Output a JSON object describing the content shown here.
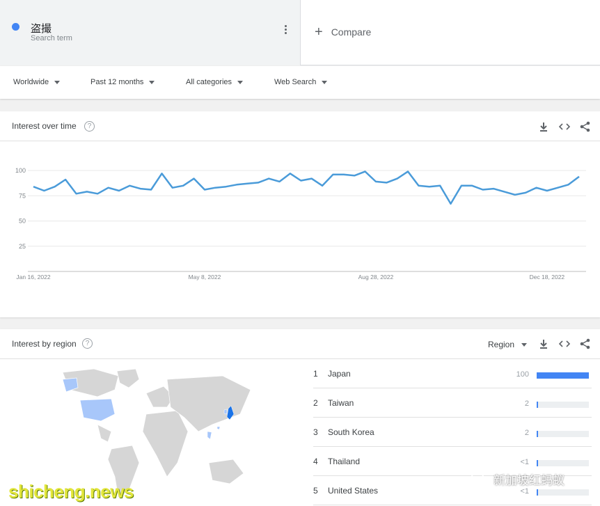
{
  "search_term": {
    "name": "盗撮",
    "subtitle": "Search term",
    "color": "#4285f4"
  },
  "compare_label": "Compare",
  "filters": [
    {
      "label": "Worldwide"
    },
    {
      "label": "Past 12 months"
    },
    {
      "label": "All categories"
    },
    {
      "label": "Web Search"
    }
  ],
  "interest_over_time": {
    "title": "Interest over time",
    "help": "?",
    "chart_data": {
      "type": "line",
      "color": "#4a9bd9",
      "ylim": [
        0,
        100
      ],
      "yticks": [
        25,
        50,
        75,
        100
      ],
      "x_ticks": [
        "Jan 16, 2022",
        "May 8, 2022",
        "Aug 28, 2022",
        "Dec 18, 2022"
      ],
      "grid": true,
      "series": [
        {
          "values": [
            84,
            80,
            84,
            91,
            77,
            79,
            77,
            83,
            80,
            85,
            82,
            81,
            97,
            83,
            85,
            92,
            81,
            83,
            84,
            86,
            87,
            88,
            92,
            89,
            97,
            90,
            92,
            85,
            96,
            96,
            95,
            99,
            89,
            88,
            92,
            99,
            85,
            84,
            85,
            67,
            85,
            85,
            81,
            82,
            79,
            76,
            78,
            83,
            80,
            83,
            86,
            94
          ]
        }
      ]
    }
  },
  "interest_by_region": {
    "title": "Interest by region",
    "help": "?",
    "region_selector": "Region",
    "rows": [
      {
        "rank": "1",
        "name": "Japan",
        "value": "100",
        "fill": 1.0
      },
      {
        "rank": "2",
        "name": "Taiwan",
        "value": "2",
        "fill": 0.02
      },
      {
        "rank": "3",
        "name": "South Korea",
        "value": "2",
        "fill": 0.02
      },
      {
        "rank": "4",
        "name": "Thailand",
        "value": "<1",
        "fill": 0.01
      },
      {
        "rank": "5",
        "name": "United States",
        "value": "<1",
        "fill": 0.01
      }
    ]
  },
  "overlays": {
    "site_watermark": "shicheng.news",
    "wechat_label": "新加坡红蚂蚁"
  }
}
